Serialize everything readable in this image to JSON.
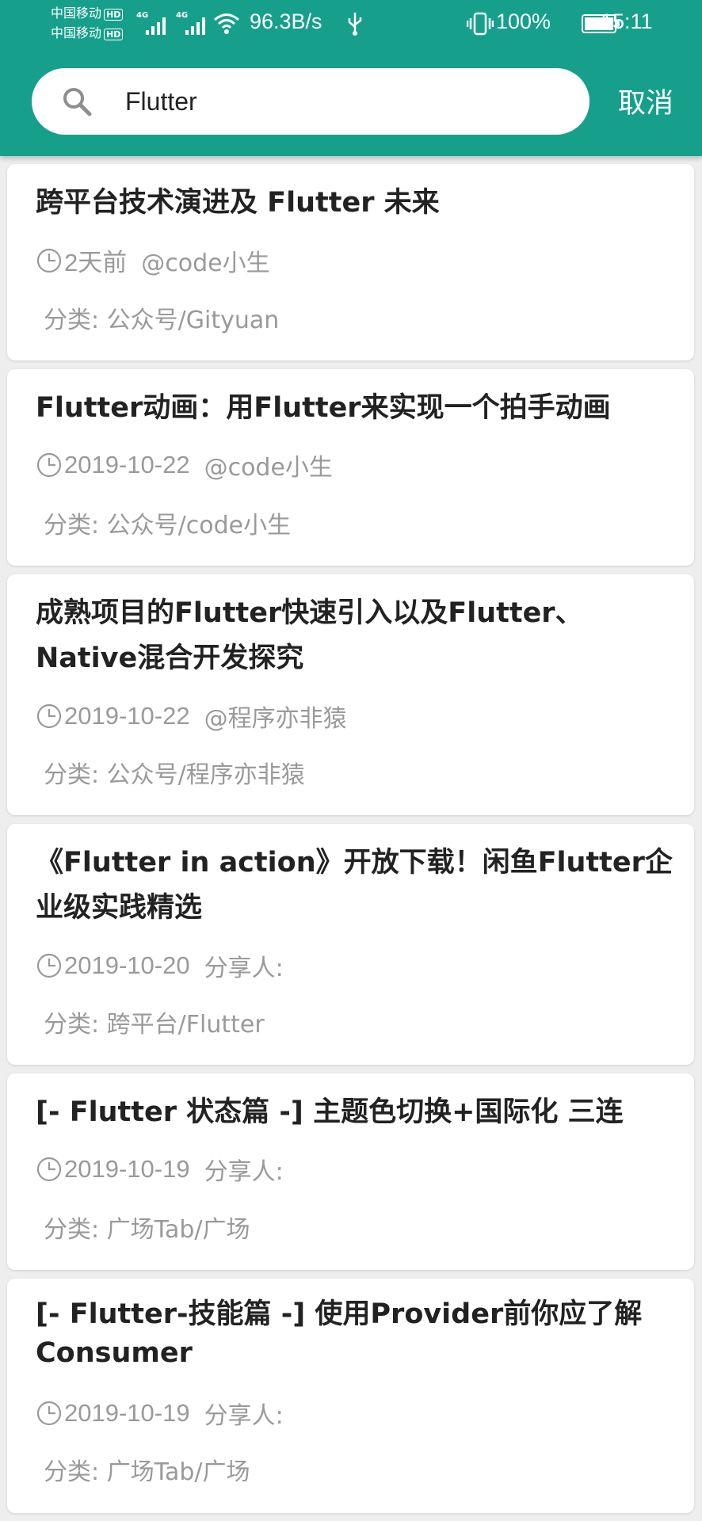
{
  "status_bar": {
    "carrier1": "中国移动",
    "carrier2": "中国移动",
    "hd": "HD",
    "net1": "4G",
    "net2": "4G",
    "speed": "96.3B/s",
    "battery": "100%",
    "time": "15:11"
  },
  "search": {
    "query": "Flutter",
    "cancel": "取消"
  },
  "results": [
    {
      "title": "跨平台技术演进及 Flutter 未来",
      "date": "2天前",
      "author": "@code小生",
      "category": "分类: 公众号/Gityuan"
    },
    {
      "title": "Flutter动画：用Flutter来实现一个拍手动画",
      "date": "2019-10-22",
      "author": "@code小生",
      "category": "分类: 公众号/code小生"
    },
    {
      "title": "成熟项目的Flutter快速引入以及Flutter、Native混合开发探究",
      "date": "2019-10-22",
      "author": "@程序亦非猿",
      "category": "分类: 公众号/程序亦非猿"
    },
    {
      "title": "《Flutter in action》开放下载！闲鱼Flutter企业级实践精选",
      "date": "2019-10-20",
      "author": "分享人:",
      "category": "分类: 跨平台/Flutter"
    },
    {
      "title": "[- Flutter 状态篇 -] 主题色切换+国际化 三连",
      "date": "2019-10-19",
      "author": "分享人:",
      "category": "分类: 广场Tab/广场"
    },
    {
      "title": "[- Flutter-技能篇 -] 使用Provider前你应了解Consumer",
      "date": "2019-10-19",
      "author": "分享人:",
      "category": "分类: 广场Tab/广场"
    }
  ],
  "colors": {
    "primary": "#16a08c",
    "card": "#ffffff",
    "background": "#eeeeee",
    "title_text": "#222222",
    "meta_text": "#9a9a9a"
  }
}
